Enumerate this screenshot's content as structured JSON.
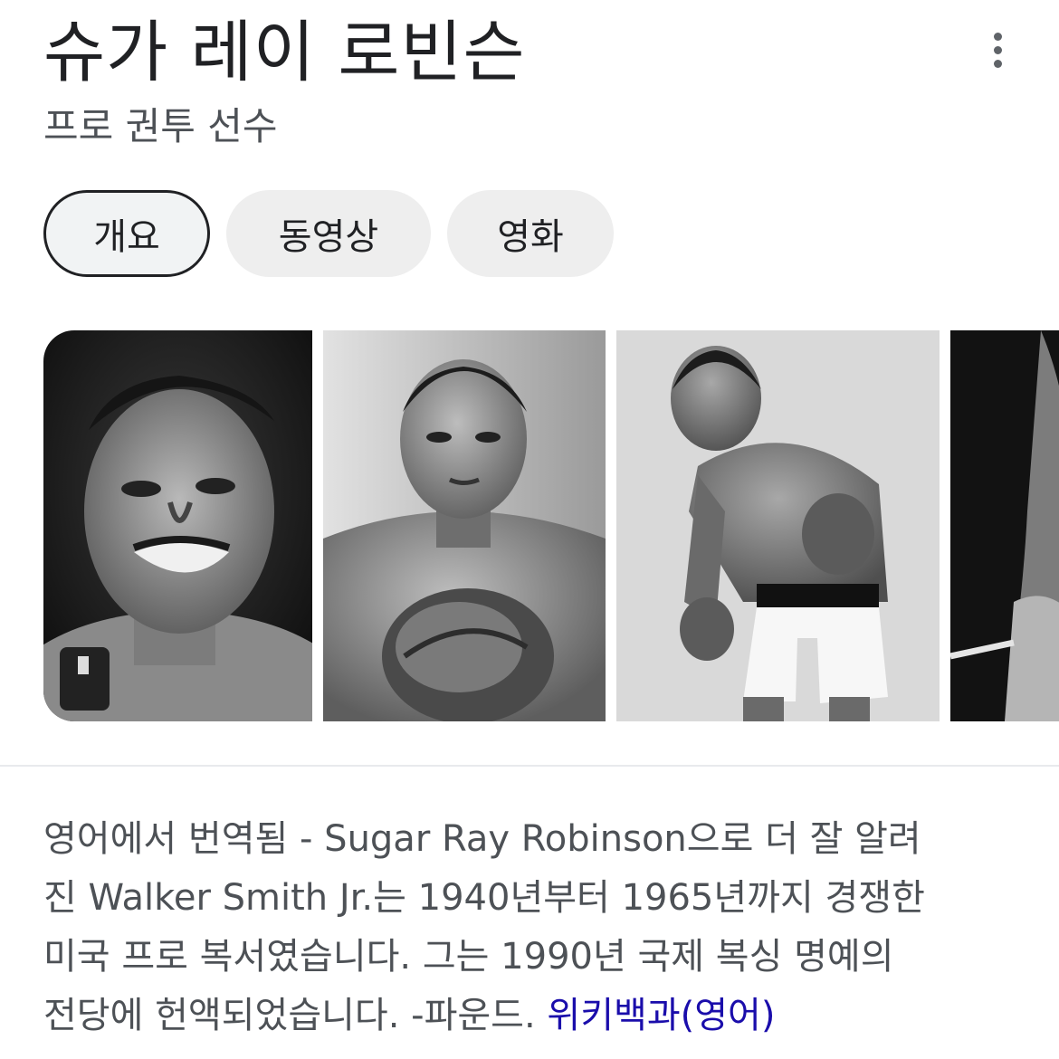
{
  "header": {
    "title": "슈가 레이 로빈슨",
    "subtitle": "프로 권투 선수",
    "more_icon": "more-vert-icon"
  },
  "tabs": [
    {
      "label": "개요",
      "active": true
    },
    {
      "label": "동영상",
      "active": false
    },
    {
      "label": "영화",
      "active": false
    }
  ],
  "gallery": {
    "images": [
      {
        "subject": "smiling-boxer-closeup"
      },
      {
        "subject": "boxer-guard-pose"
      },
      {
        "subject": "boxer-stance-white-trunks"
      },
      {
        "subject": "boxer-partial"
      }
    ]
  },
  "description": {
    "lines": [
      "영어에서 번역됨 - Sugar Ray Robinson으로 더 잘 알려",
      "진 Walker Smith Jr.는 1940년부터 1965년까지 경쟁한",
      "미국 프로 복서였습니다. 그는 1990년 국제 복싱 명예의",
      "전당에 헌액되었습니다. -파운드. "
    ],
    "source_link": "위키백과(영어)"
  },
  "colors": {
    "link": "#1a0dab",
    "text": "#202124",
    "secondary_text": "#4d5156",
    "chip_bg": "#eeeeee"
  }
}
